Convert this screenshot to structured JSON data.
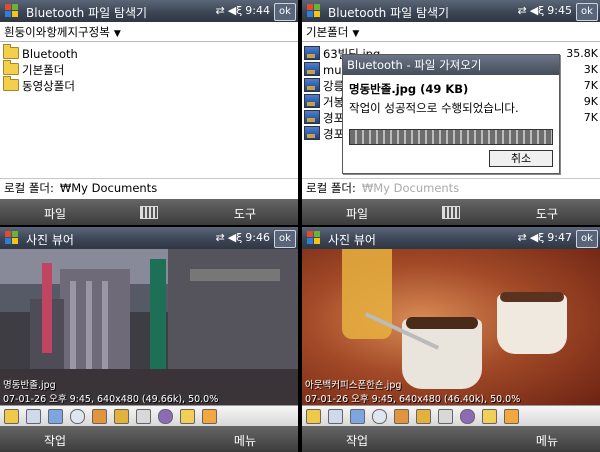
{
  "panel1": {
    "title": "Bluetooth 파일 탐색기",
    "time": "9:44",
    "ok": "ok",
    "path": "흰둥이와항께지구정복",
    "folders": [
      "Bluetooth",
      "기본폴더",
      "동영상폴더"
    ],
    "local_label": "로컬 폴더:",
    "local_value": "₩My Documents",
    "menu_left": "파일",
    "menu_right": "도구"
  },
  "panel2": {
    "title": "Bluetooth 파일 탐색기",
    "time": "9:45",
    "ok": "ok",
    "path": "기본폴더",
    "files": [
      "63빌딩.jpg",
      "mun",
      "강릉",
      "거봉",
      "경포",
      "경포"
    ],
    "sizes": [
      "35.8K",
      "3K",
      "7K",
      "9K",
      "7K",
      ""
    ],
    "dialog_title": "Bluetooth - 파일 가져오기",
    "dialog_file": "명동반졸.jpg (49 KB)",
    "dialog_msg": "작업이 성공적으로 수행되었습니다.",
    "cancel": "취소",
    "progress": 1.0,
    "local_label": "로컬 폴더:",
    "local_value": "₩My Documents",
    "menu_left": "파일",
    "menu_right": "도구"
  },
  "panel3": {
    "title": "사진 뷰어",
    "time": "9:46",
    "ok": "ok",
    "caption_name": "명동반졸.jpg",
    "caption_info": "07-01-26 오후 9:45, 640x480 (49.66k), 50.0%",
    "menu_left": "작업",
    "menu_right": "메뉴"
  },
  "panel4": {
    "title": "사진 뷰어",
    "time": "9:47",
    "ok": "ok",
    "caption_name": "아웃백커피스폰한숀.jpg",
    "caption_info": "07-01-26 오후 9:45, 640x480 (46.40k), 50.0%",
    "menu_left": "작업",
    "menu_right": "메뉴"
  },
  "tray_icons": [
    "connectivity-icon",
    "speaker-icon"
  ],
  "colors": {
    "titlebar": "#3d4656",
    "folder": "#f4cf4c",
    "menubar": "#3c3c3c"
  }
}
